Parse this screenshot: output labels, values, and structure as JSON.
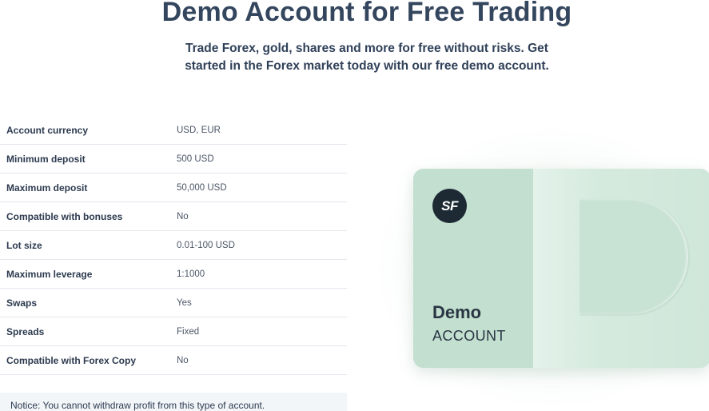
{
  "hero": {
    "title": "Demo Account for Free Trading",
    "subtitle": "Trade Forex, gold, shares and more for free without risks. Get started in the Forex market today with our free demo account."
  },
  "specs": [
    {
      "label": "Account currency",
      "value": "USD, EUR"
    },
    {
      "label": "Minimum deposit",
      "value": "500 USD"
    },
    {
      "label": "Maximum deposit",
      "value": "50,000 USD"
    },
    {
      "label": "Compatible with bonuses",
      "value": "No"
    },
    {
      "label": "Lot size",
      "value": "0.01-100 USD"
    },
    {
      "label": "Maximum leverage",
      "value": "1:1000"
    },
    {
      "label": "Swaps",
      "value": "Yes"
    },
    {
      "label": "Spreads",
      "value": "Fixed"
    },
    {
      "label": "Compatible with Forex Copy",
      "value": "No"
    }
  ],
  "notice": "Notice: You cannot withdraw profit from this type of account.",
  "card": {
    "logo_text": "SF",
    "title": "Demo",
    "subtitle": "ACCOUNT"
  },
  "colors": {
    "heading": "#34465e",
    "card_green": "#c5e1d2",
    "logo_bg": "#1d2a34",
    "notice_bg": "#f2f6f9"
  }
}
